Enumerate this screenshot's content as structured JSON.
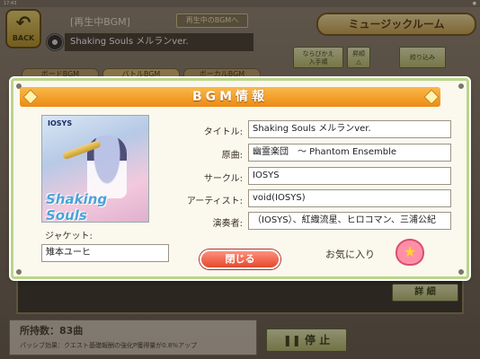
{
  "status": {
    "time": "17:43",
    "wifi": "●"
  },
  "nav": {
    "back_label": "BACK"
  },
  "now_playing": {
    "title": "[再生中BGM]",
    "link_label": "再生中のBGMへ",
    "song": "Shaking Souls メルランver."
  },
  "music_room": {
    "title": "ミュージックルーム"
  },
  "sort_buttons": {
    "reorder": "ならびかえ",
    "reorder_sub": "入手順",
    "ascending": "昇順",
    "filter": "絞り込み"
  },
  "tabs": [
    "ボードBGM",
    "バトルBGM",
    "ボーカルBGM"
  ],
  "bottom": {
    "detail": "詳 細",
    "owned": "所持数：83曲",
    "passive": "パッシブ効果：クエスト基礎報酬の強化P獲得量が0.8%アップ",
    "stop": "停 止"
  },
  "modal": {
    "header": "BGM情報",
    "jacket_label": "ジャケット:",
    "jacket_credit": "雉本ユーヒ",
    "jacket_art": {
      "brand": "IOSYS",
      "logo": "Shaking Souls"
    },
    "fields": [
      {
        "label": "タイトル:",
        "value": "Shaking Souls メルランver."
      },
      {
        "label": "原曲:",
        "value": "幽霊楽団　～ Phantom Ensemble"
      },
      {
        "label": "サークル:",
        "value": "IOSYS"
      },
      {
        "label": "アーティスト:",
        "value": "void(IOSYS)"
      },
      {
        "label": "演奏者:",
        "value": "（IOSYS）、紅織流星、ヒロコマン、三浦公紀"
      }
    ],
    "close_label": "閉じる",
    "favorite_label": "お気に入り"
  },
  "colors": {
    "header_orange": "#ec8a14",
    "close_red": "#e24a2e",
    "modal_border": "#b9d58a"
  }
}
